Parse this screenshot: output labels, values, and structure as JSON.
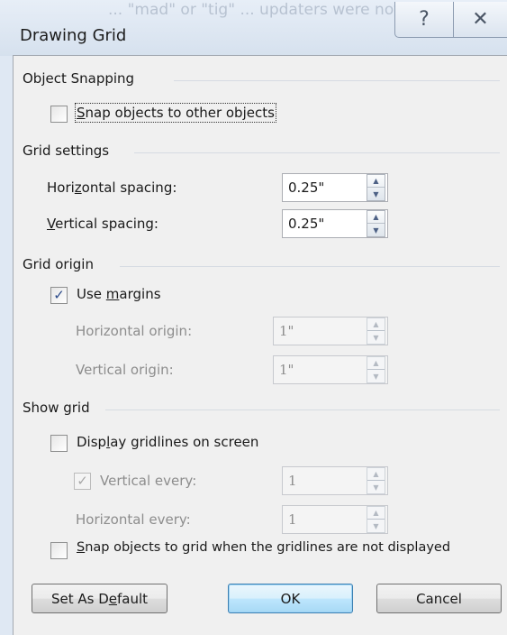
{
  "window": {
    "title": "Drawing Grid",
    "background_text": "... \"mad\" or \"tig\" ... updaters were noticed on a page for reviewing",
    "help_icon": "help-icon",
    "close_icon": "close-icon"
  },
  "object_snapping": {
    "heading": "Object Snapping",
    "snap_objects": {
      "pre": "",
      "key": "S",
      "post": "nap objects to other objects",
      "checked": false
    }
  },
  "grid_settings": {
    "heading": "Grid settings",
    "horizontal_spacing": {
      "pre": "Hori",
      "key": "z",
      "post": "ontal spacing:",
      "value": "0.25\""
    },
    "vertical_spacing": {
      "pre": "",
      "key": "V",
      "post": "ertical spacing:",
      "value": "0.25\""
    }
  },
  "grid_origin": {
    "heading": "Grid origin",
    "use_margins": {
      "pre": "Use ",
      "key": "m",
      "post": "argins",
      "checked": true
    },
    "horizontal_origin": {
      "label": "Horizontal origin:",
      "value": "1\""
    },
    "vertical_origin": {
      "label": "Vertical origin:",
      "value": "1\""
    }
  },
  "show_grid": {
    "heading": "Show grid",
    "display_gridlines": {
      "pre": "Disp",
      "key": "l",
      "post": "ay gridlines on screen",
      "checked": false
    },
    "vertical_every": {
      "label": "Vertical every:",
      "value": "1",
      "checked": true
    },
    "horizontal_every": {
      "label": "Horizontal every:",
      "value": "1"
    },
    "snap_when_hidden": {
      "pre": "",
      "key": "S",
      "post": "nap objects to grid when the gridlines are not displayed",
      "checked": false
    }
  },
  "buttons": {
    "set_default": {
      "pre": "Set As D",
      "key": "e",
      "post": "fault"
    },
    "ok": "OK",
    "cancel": "Cancel"
  },
  "glyphs": {
    "check": "✓",
    "up": "▲",
    "down": "▼",
    "help": "?",
    "close": "✕"
  }
}
